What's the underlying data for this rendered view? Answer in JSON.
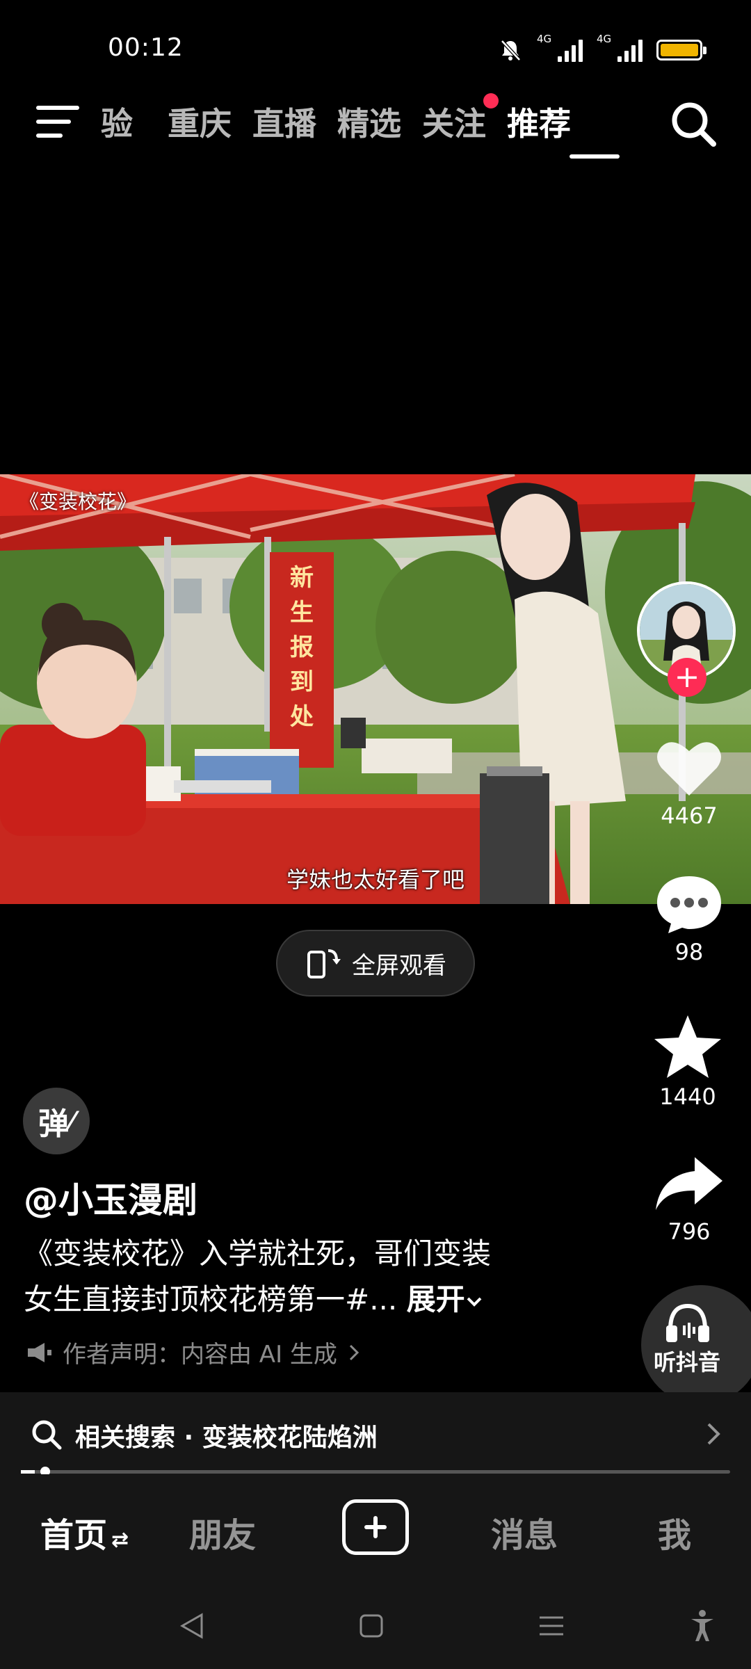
{
  "status_bar": {
    "time": "00:12",
    "signal_1_label": "4G",
    "signal_2_label": "4G"
  },
  "top_nav": {
    "tabs": [
      {
        "label": "验"
      },
      {
        "label": "重庆"
      },
      {
        "label": "直播"
      },
      {
        "label": "精选"
      },
      {
        "label": "关注"
      },
      {
        "label": "推荐"
      }
    ],
    "active_tab": "推荐"
  },
  "video": {
    "title_tag": "《变装校花》",
    "banner_text": "新生报到处",
    "subtitle": "学妹也太好看了吧",
    "fullscreen_label": "全屏观看"
  },
  "actions": {
    "likes": "4467",
    "comments": "98",
    "favorites": "1440",
    "shares": "796",
    "listen_label": "听抖音"
  },
  "post": {
    "danmu_label": "弹",
    "author": "@小玉漫剧",
    "description_line1": "《变装校花》入学就社死，哥们变装",
    "description_line2": "女生直接封顶校花榜第一#...",
    "expand_label": "展开",
    "ai_note": "作者声明：内容由 AI 生成"
  },
  "related_search": {
    "text": "相关搜索 · 变装校花陆焰洲"
  },
  "progress": 0.02,
  "bottom_tabs": {
    "home": "首页",
    "friends": "朋友",
    "messages": "消息",
    "me": "我"
  },
  "colors": {
    "accent": "#fe2c55",
    "battery": "#f0b400",
    "canopy": "#d9281f"
  }
}
